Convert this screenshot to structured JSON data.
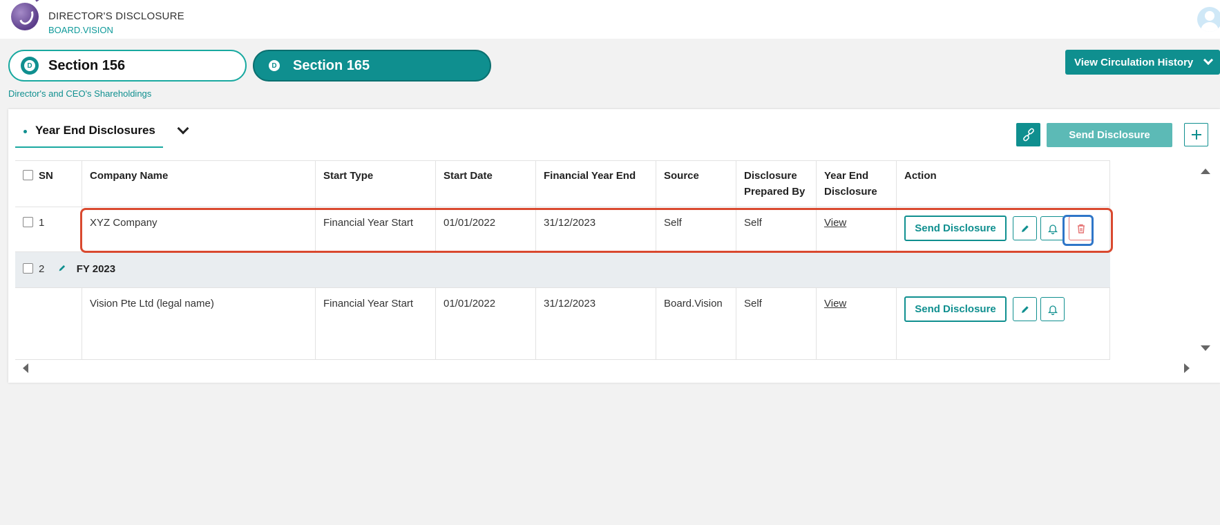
{
  "app": {
    "title": "DIRECTOR'S DISCLOSURE",
    "subtitle": "BOARD.VISION"
  },
  "sections": [
    {
      "badge": "D",
      "label": "Section 156",
      "active": false
    },
    {
      "badge": "D",
      "label": "Section 165",
      "active": true
    }
  ],
  "breadcrumb": "Director's and CEO's Shareholdings",
  "circulation_button": "View Circulation History",
  "card": {
    "tab_label": "Year End Disclosures",
    "send_button": "Send Disclosure"
  },
  "table": {
    "headers": [
      "SN",
      "Company Name",
      "Start Type",
      "Start Date",
      "Financial Year End",
      "Source",
      "Disclosure Prepared By",
      "Year End Disclosure",
      "Action"
    ],
    "rows": [
      {
        "sn": "1",
        "company": "XYZ Company",
        "start_type": "Financial Year Start",
        "start_date": "01/01/2022",
        "fy_end": "31/12/2023",
        "source": "Self",
        "prepared_by": "Self",
        "disclosure": "View",
        "action": "Send Disclosure"
      },
      {
        "sn": "2",
        "group_label": "FY 2023"
      },
      {
        "company": "Vision Pte Ltd (legal name)",
        "start_type": "Financial Year Start",
        "start_date": "01/01/2022",
        "fy_end": "31/12/2023",
        "source": "Board.Vision",
        "prepared_by": "Self",
        "disclosure": "View",
        "action": "Send Disclosure"
      }
    ]
  },
  "colors": {
    "accent": "#0f8f8f",
    "accent_light": "#5cbab6",
    "highlight_red": "#d9492f",
    "focus_blue": "#2f76c8",
    "delete_red": "#e57373"
  }
}
